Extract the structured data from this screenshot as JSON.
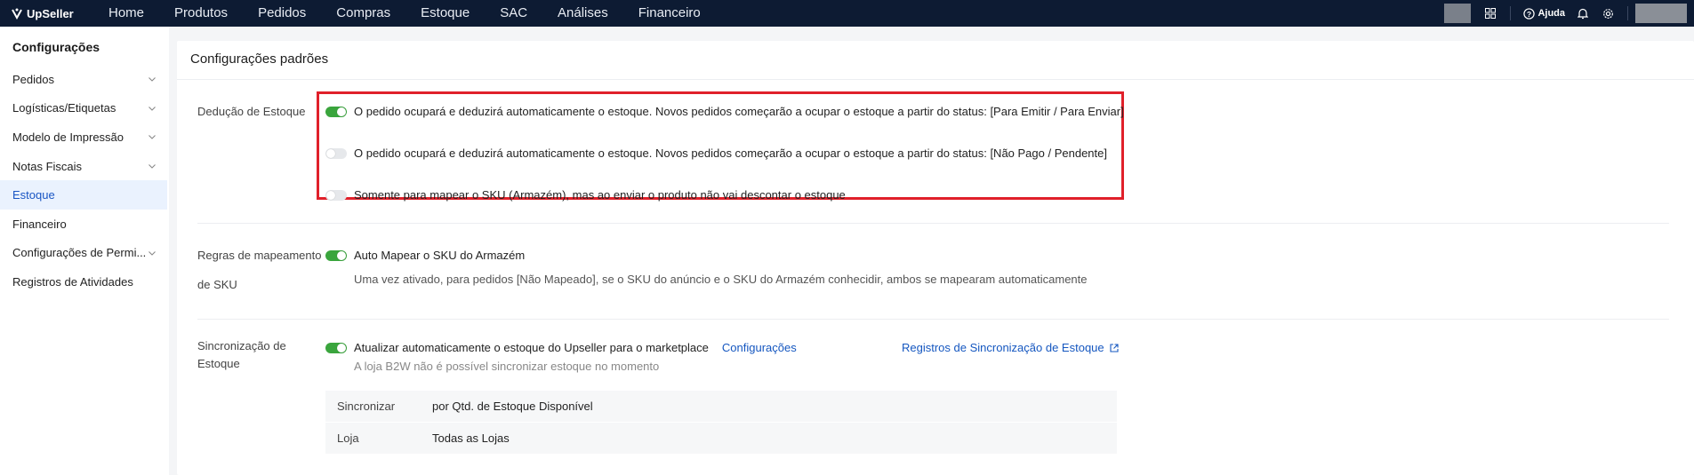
{
  "app": {
    "logo_text": "UpSeller"
  },
  "nav": {
    "items": [
      "Home",
      "Produtos",
      "Pedidos",
      "Compras",
      "Estoque",
      "SAC",
      "Análises",
      "Financeiro"
    ],
    "help_label": "Ajuda"
  },
  "sidebar": {
    "title": "Configurações",
    "items": [
      {
        "label": "Pedidos",
        "has_chevron": true
      },
      {
        "label": "Logísticas/Etiquetas",
        "has_chevron": true
      },
      {
        "label": "Modelo de Impressão",
        "has_chevron": true
      },
      {
        "label": "Notas Fiscais",
        "has_chevron": true
      },
      {
        "label": "Estoque",
        "has_chevron": false,
        "active": true
      },
      {
        "label": "Financeiro",
        "has_chevron": false
      },
      {
        "label": "Configurações de Permi...",
        "has_chevron": true
      },
      {
        "label": "Registros de Atividades",
        "has_chevron": false
      }
    ]
  },
  "main": {
    "title": "Configurações padrões",
    "stock_deduction": {
      "label": "Dedução de Estoque",
      "options": [
        {
          "text": "O pedido ocupará e deduzirá automaticamente o estoque. Novos pedidos começarão a ocupar o estoque a partir do status: [Para Emitir / Para Enviar]",
          "enabled": true
        },
        {
          "text": "O pedido ocupará e deduzirá automaticamente o estoque. Novos pedidos começarão a ocupar o estoque a partir do status: [Não Pago / Pendente]",
          "enabled": false
        },
        {
          "text": "Somente para mapear o SKU (Armazém), mas ao enviar o produto não vai descontar o estoque",
          "enabled": false
        }
      ]
    },
    "sku_mapping": {
      "label_line1": "Regras de mapeamento",
      "label_line2": "de SKU",
      "toggle_text": "Auto Mapear o SKU do Armazém",
      "enabled": true,
      "description": "Uma vez ativado, para pedidos [Não Mapeado], se o SKU do anúncio e o SKU do Armazém conhecidir, ambos se mapearam automaticamente"
    },
    "stock_sync": {
      "label_line1": "Sincronização de",
      "label_line2": "Estoque",
      "toggle_text": "Atualizar automaticamente o estoque do Upseller para o marketplace",
      "enabled": true,
      "config_link": "Configurações",
      "records_link": "Registros de Sincronização de Estoque",
      "note": "A loja B2W não é possível sincronizar estoque no momento",
      "table": [
        {
          "key": "Sincronizar",
          "value": "por Qtd. de Estoque Disponível"
        },
        {
          "key": "Loja",
          "value": "Todas as Lojas"
        }
      ]
    }
  },
  "colors": {
    "topbar": "#0d1b33",
    "accent": "#1557c0",
    "toggle_on": "#3aa53d",
    "highlight": "#e0202a"
  }
}
